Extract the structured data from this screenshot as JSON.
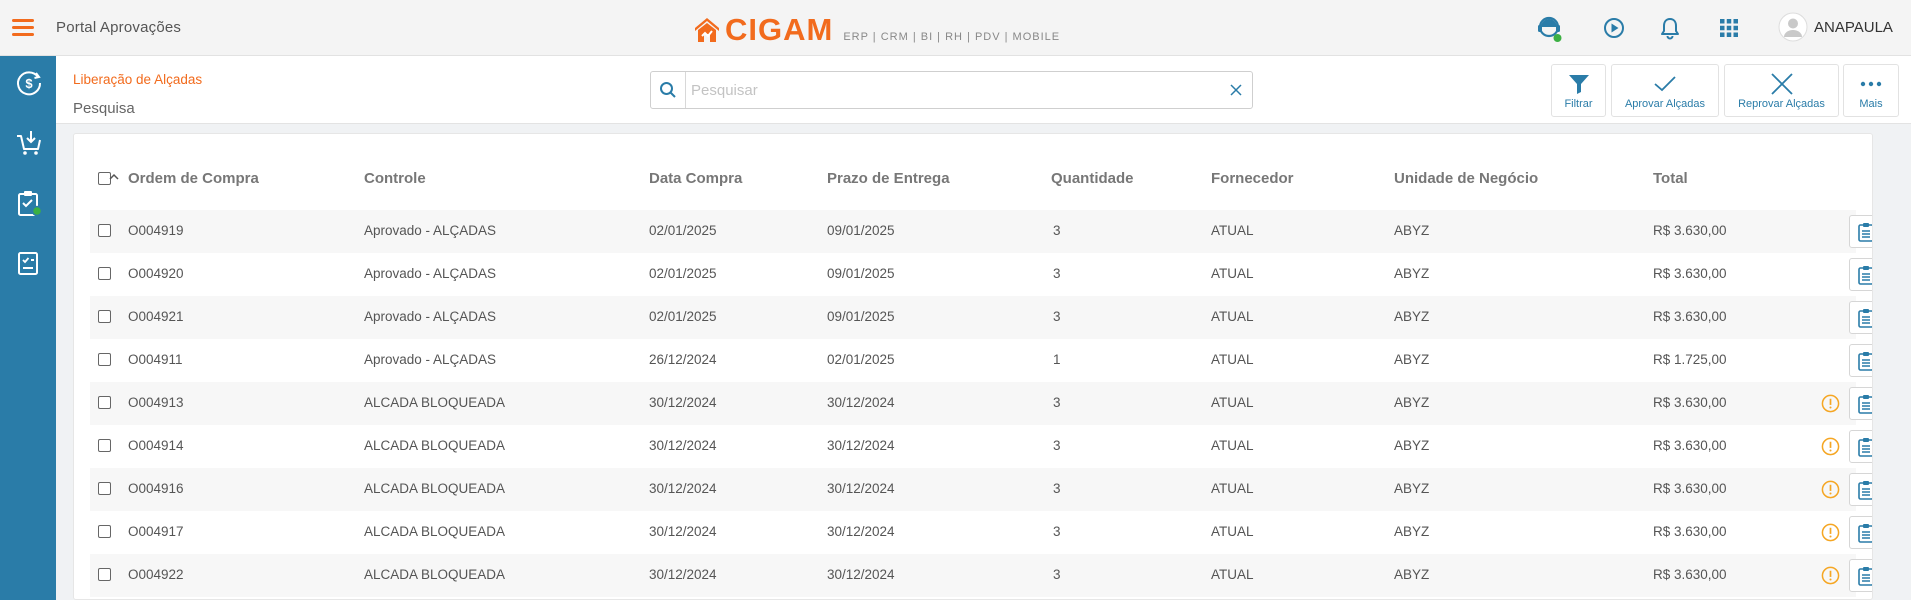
{
  "app": {
    "title": "Portal Aprovações",
    "brand": "CIGAM",
    "brand_sub": "ERP | CRM | BI | RH | PDV | MOBILE",
    "user_name": "ANAPAULA",
    "accent": "#f26b1d",
    "sidebar_color": "#2a7ca8"
  },
  "icons": {
    "menu": "hamburger-icon",
    "support": "support-agent-icon",
    "play": "play-circle-icon",
    "notifications": "bell-icon",
    "apps": "apps-grid-icon",
    "user": "user-avatar-icon"
  },
  "sidebar": {
    "items": [
      {
        "name": "dollar-circle-icon"
      },
      {
        "name": "cart-download-icon"
      },
      {
        "name": "clipboard-check-icon"
      },
      {
        "name": "approval-checklist-icon"
      }
    ]
  },
  "page": {
    "breadcrumb": "Liberação de Alçadas",
    "title": "Pesquisa"
  },
  "search": {
    "placeholder": "Pesquisar",
    "value": ""
  },
  "actions": {
    "filter": "Filtrar",
    "approve": "Aprovar Alçadas",
    "reject": "Reprovar Alçadas",
    "more": "Mais"
  },
  "table": {
    "columns": [
      "Ordem de Compra",
      "Controle",
      "Data Compra",
      "Prazo de Entrega",
      "Quantidade",
      "Fornecedor",
      "Unidade de Negócio",
      "Total"
    ],
    "rows": [
      {
        "ordem": "O004919",
        "controle": "Aprovado - ALÇADAS",
        "data": "02/01/2025",
        "prazo": "09/01/2025",
        "qtd": "3",
        "fornecedor": "ATUAL",
        "unidade": "ABYZ",
        "total": "R$ 3.630,00",
        "warning": false
      },
      {
        "ordem": "O004920",
        "controle": "Aprovado - ALÇADAS",
        "data": "02/01/2025",
        "prazo": "09/01/2025",
        "qtd": "3",
        "fornecedor": "ATUAL",
        "unidade": "ABYZ",
        "total": "R$ 3.630,00",
        "warning": false
      },
      {
        "ordem": "O004921",
        "controle": "Aprovado - ALÇADAS",
        "data": "02/01/2025",
        "prazo": "09/01/2025",
        "qtd": "3",
        "fornecedor": "ATUAL",
        "unidade": "ABYZ",
        "total": "R$ 3.630,00",
        "warning": false
      },
      {
        "ordem": "O004911",
        "controle": "Aprovado - ALÇADAS",
        "data": "26/12/2024",
        "prazo": "02/01/2025",
        "qtd": "1",
        "fornecedor": "ATUAL",
        "unidade": "ABYZ",
        "total": "R$ 1.725,00",
        "warning": false
      },
      {
        "ordem": "O004913",
        "controle": "ALCADA BLOQUEADA",
        "data": "30/12/2024",
        "prazo": "30/12/2024",
        "qtd": "3",
        "fornecedor": "ATUAL",
        "unidade": "ABYZ",
        "total": "R$ 3.630,00",
        "warning": true
      },
      {
        "ordem": "O004914",
        "controle": "ALCADA BLOQUEADA",
        "data": "30/12/2024",
        "prazo": "30/12/2024",
        "qtd": "3",
        "fornecedor": "ATUAL",
        "unidade": "ABYZ",
        "total": "R$ 3.630,00",
        "warning": true
      },
      {
        "ordem": "O004916",
        "controle": "ALCADA BLOQUEADA",
        "data": "30/12/2024",
        "prazo": "30/12/2024",
        "qtd": "3",
        "fornecedor": "ATUAL",
        "unidade": "ABYZ",
        "total": "R$ 3.630,00",
        "warning": true
      },
      {
        "ordem": "O004917",
        "controle": "ALCADA BLOQUEADA",
        "data": "30/12/2024",
        "prazo": "30/12/2024",
        "qtd": "3",
        "fornecedor": "ATUAL",
        "unidade": "ABYZ",
        "total": "R$ 3.630,00",
        "warning": true
      },
      {
        "ordem": "O004922",
        "controle": "ALCADA BLOQUEADA",
        "data": "30/12/2024",
        "prazo": "30/12/2024",
        "qtd": "3",
        "fornecedor": "ATUAL",
        "unidade": "ABYZ",
        "total": "R$ 3.630,00",
        "warning": true
      }
    ]
  }
}
